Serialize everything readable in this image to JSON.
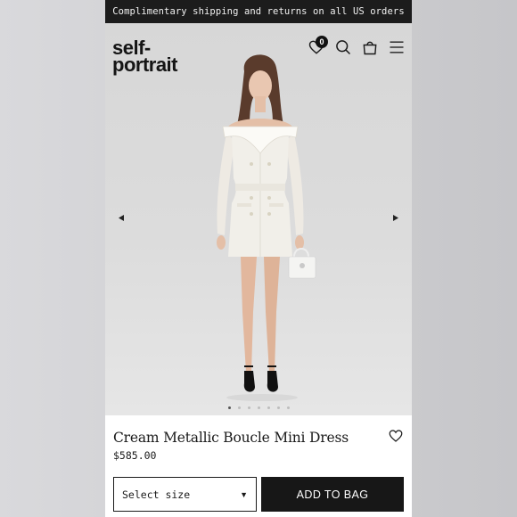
{
  "promo": {
    "text": "Complimentary shipping and returns on all US orders"
  },
  "header": {
    "logo": "self-\nportrait",
    "wishlist_count": "0",
    "icons": [
      "heart-icon",
      "search-icon",
      "shopping-bag-icon",
      "menu-icon"
    ]
  },
  "gallery": {
    "slide_count": 7,
    "active_slide": 1,
    "image_subject": "model wearing cream double-breasted boucle mini dress with white handbag and black heels"
  },
  "product": {
    "title": "Cream Metallic Boucle Mini Dress",
    "price": "$585.00"
  },
  "purchase": {
    "size_placeholder": "Select size",
    "add_to_bag_label": "ADD TO BAG"
  },
  "colors": {
    "promo_bg": "#1c1c1c",
    "button_bg": "#171717",
    "hero_bg": "#d9d9d9"
  }
}
